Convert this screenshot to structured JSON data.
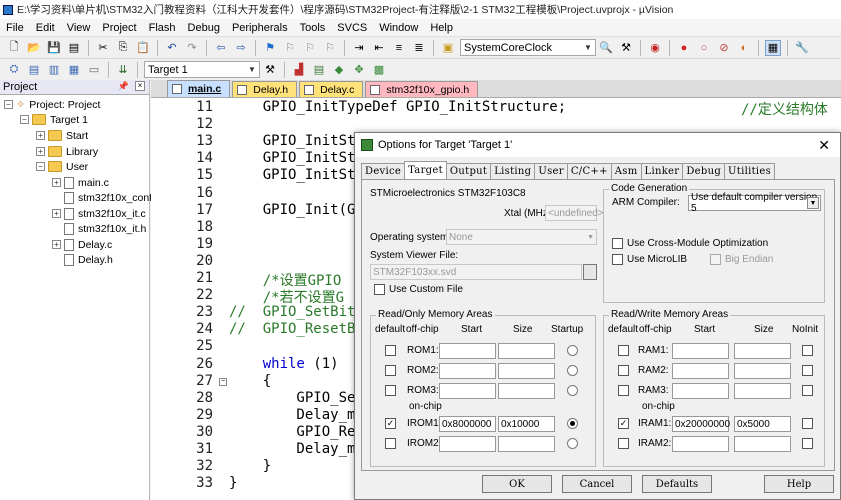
{
  "window": {
    "title": "E:\\学习资料\\单片机\\STM32入门教程资料（江科大开发套件）\\程序源码\\STM32Project-有注释版\\2-1 STM32工程模板\\Project.uvprojx - µVision"
  },
  "menu": [
    "File",
    "Edit",
    "View",
    "Project",
    "Flash",
    "Debug",
    "Peripherals",
    "Tools",
    "SVCS",
    "Window",
    "Help"
  ],
  "toolbar": {
    "function_combo": "SystemCoreClock",
    "target_combo": "Target 1"
  },
  "project_panel": {
    "title": "Project",
    "items": [
      {
        "label": "Project: Project"
      },
      {
        "label": "Target 1"
      },
      {
        "label": "Start"
      },
      {
        "label": "Library"
      },
      {
        "label": "User"
      },
      {
        "label": "main.c"
      },
      {
        "label": "stm32f10x_conf"
      },
      {
        "label": "stm32f10x_it.c"
      },
      {
        "label": "stm32f10x_it.h"
      },
      {
        "label": "Delay.c"
      },
      {
        "label": "Delay.h"
      }
    ]
  },
  "editor": {
    "tabs": [
      {
        "label": "main.c",
        "color": "#c8e0ff"
      },
      {
        "label": "Delay.h",
        "color": "#ffe27a"
      },
      {
        "label": "Delay.c",
        "color": "#ffe27a"
      },
      {
        "label": "stm32f10x_gpio.h",
        "color": "#ffb8c0"
      }
    ],
    "lines": [
      {
        "n": "11",
        "text": "    GPIO_InitTypeDef GPIO_InitStructure;",
        "comment": "//定义结构体"
      },
      {
        "n": "12",
        "text": ""
      },
      {
        "n": "13",
        "text": "    GPIO_InitSt"
      },
      {
        "n": "14",
        "text": "    GPIO_InitSt"
      },
      {
        "n": "15",
        "text": "    GPIO_InitSt"
      },
      {
        "n": "16",
        "text": ""
      },
      {
        "n": "17",
        "text": "    GPIO_Init(G"
      },
      {
        "n": "18",
        "text": ""
      },
      {
        "n": "19",
        "text": ""
      },
      {
        "n": "20",
        "text": ""
      },
      {
        "n": "21",
        "text": "    /*设置GPIO",
        "is_comment": true
      },
      {
        "n": "22",
        "text": "    /*若不设置G",
        "is_comment": true
      },
      {
        "n": "23",
        "text": "//  GPIO_SetBit",
        "is_comment": true
      },
      {
        "n": "24",
        "text": "//  GPIO_ResetB",
        "is_comment": true
      },
      {
        "n": "25",
        "text": ""
      },
      {
        "n": "26",
        "text": "    while (1)",
        "keyword": "while"
      },
      {
        "n": "27",
        "text": "    {"
      },
      {
        "n": "28",
        "text": "        GPIO_Se"
      },
      {
        "n": "29",
        "text": "        Delay_m"
      },
      {
        "n": "30",
        "text": "        GPIO_Re"
      },
      {
        "n": "31",
        "text": "        Delay_m"
      },
      {
        "n": "32",
        "text": "    }"
      },
      {
        "n": "33",
        "text": "}"
      }
    ]
  },
  "dialog": {
    "title": "Options for Target 'Target 1'",
    "close": "✕",
    "tabs": [
      "Device",
      "Target",
      "Output",
      "Listing",
      "User",
      "C/C++",
      "Asm",
      "Linker",
      "Debug",
      "Utilities"
    ],
    "active_tab": "Target",
    "device_name": "STMicroelectronics STM32F103C8",
    "xtal_label": "Xtal (MHz):",
    "xtal_value": "<undefined>",
    "os_label": "Operating system:",
    "os_value": "None",
    "svd_label": "System Viewer File:",
    "svd_value": "STM32F103xx.svd",
    "custom_file_label": "Use Custom File",
    "code_gen": {
      "title": "Code Generation",
      "compiler_label": "ARM Compiler:",
      "compiler_value": "Use default compiler version 5",
      "cross_module": "Use Cross-Module Optimization",
      "microlib": "Use MicroLIB",
      "big_endian": "Big Endian"
    },
    "ro_mem": {
      "title": "Read/Only Memory Areas",
      "headers": [
        "default",
        "off-chip",
        "Start",
        "Size",
        "Startup"
      ],
      "on_chip": "on-chip",
      "rows": [
        {
          "name": "ROM1:",
          "start": "",
          "size": "",
          "checked": false,
          "startup": false
        },
        {
          "name": "ROM2:",
          "start": "",
          "size": "",
          "checked": false,
          "startup": false
        },
        {
          "name": "ROM3:",
          "start": "",
          "size": "",
          "checked": false,
          "startup": false
        },
        {
          "name": "IROM1:",
          "start": "0x8000000",
          "size": "0x10000",
          "checked": true,
          "startup": true
        },
        {
          "name": "IROM2:",
          "start": "",
          "size": "",
          "checked": false,
          "startup": false
        }
      ]
    },
    "rw_mem": {
      "title": "Read/Write Memory Areas",
      "headers": [
        "default",
        "off-chip",
        "Start",
        "Size",
        "NoInit"
      ],
      "on_chip": "on-chip",
      "rows": [
        {
          "name": "RAM1:",
          "start": "",
          "size": "",
          "checked": false
        },
        {
          "name": "RAM2:",
          "start": "",
          "size": "",
          "checked": false
        },
        {
          "name": "RAM3:",
          "start": "",
          "size": "",
          "checked": false
        },
        {
          "name": "IRAM1:",
          "start": "0x20000000",
          "size": "0x5000",
          "checked": true
        },
        {
          "name": "IRAM2:",
          "start": "",
          "size": "",
          "checked": false
        }
      ]
    },
    "buttons": {
      "ok": "OK",
      "cancel": "Cancel",
      "defaults": "Defaults",
      "help": "Help"
    }
  }
}
